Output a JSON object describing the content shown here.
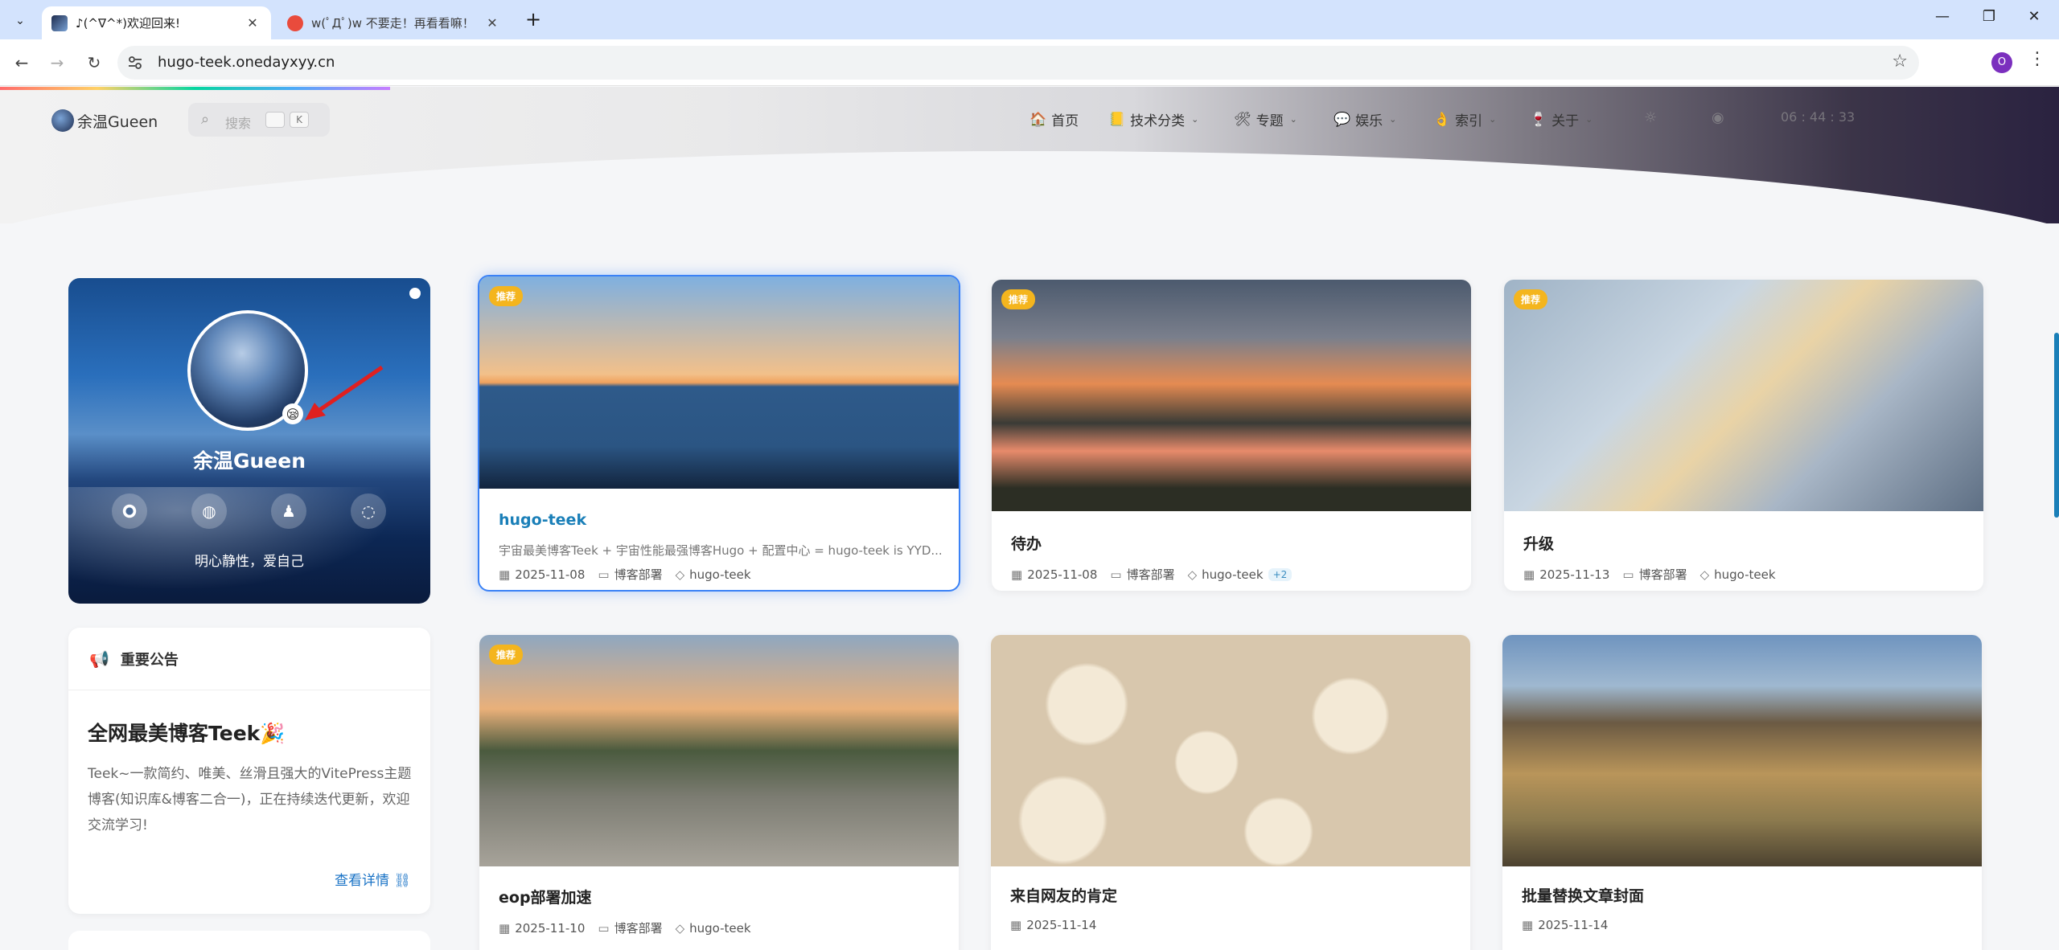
{
  "browser": {
    "tabs": [
      {
        "title": "♪(^∇^*)欢迎回来!",
        "active": true
      },
      {
        "title": "w(ﾟДﾟ)w 不要走！再看看嘛！",
        "active": false
      }
    ],
    "url": "hugo-teek.onedayxyy.cn",
    "profile_initial": "O"
  },
  "site": {
    "logo_text": "余温Gueen",
    "search": {
      "placeholder": "搜索",
      "key1": "",
      "key2": "K"
    },
    "nav": [
      {
        "label": "首页",
        "icon": "🏠",
        "has_dropdown": false
      },
      {
        "label": "技术分类",
        "icon": "📒",
        "has_dropdown": true
      },
      {
        "label": "专题",
        "icon": "🛠",
        "has_dropdown": true
      },
      {
        "label": "娱乐",
        "icon": "💬",
        "has_dropdown": true
      },
      {
        "label": "索引",
        "icon": "👌",
        "has_dropdown": true
      },
      {
        "label": "关于",
        "icon": "🍷",
        "has_dropdown": true
      }
    ],
    "clock": "06 : 44 : 33"
  },
  "profile": {
    "name": "余温Gueen",
    "motto": "明心静性，爱自己",
    "socials": [
      "github-icon",
      "dribbble-icon",
      "qq-icon",
      "wechat-icon"
    ],
    "status_emoji": "😪"
  },
  "notice": {
    "header": "重要公告",
    "title": "全网最美博客Teek🎉",
    "body": "Teek~一款简约、唯美、丝滑且强大的VitePress主题博客(知识库&博客二合一)，正在持续迭代更新，欢迎交流学习!",
    "link": "查看详情"
  },
  "posts": [
    {
      "title": "hugo-teek",
      "recommended": true,
      "excerpt": "宇宙最美博客Teek + 宇宙性能最强博客Hugo + 配置中心 = hugo-teek is YYD...",
      "date": "2025-11-08",
      "category": "博客部署",
      "tag": "hugo-teek",
      "extra": ""
    },
    {
      "title": "待办",
      "recommended": true,
      "excerpt": "",
      "date": "2025-11-08",
      "category": "博客部署",
      "tag": "hugo-teek",
      "extra": "+2"
    },
    {
      "title": "升级",
      "recommended": true,
      "excerpt": "",
      "date": "2025-11-13",
      "category": "博客部署",
      "tag": "hugo-teek",
      "extra": ""
    },
    {
      "title": "eop部署加速",
      "recommended": true,
      "excerpt": "",
      "date": "2025-11-10",
      "category": "博客部署",
      "tag": "hugo-teek",
      "extra": ""
    },
    {
      "title": "来自网友的肯定",
      "recommended": false,
      "excerpt": "",
      "date": "2025-11-14",
      "category": "",
      "tag": "",
      "extra": ""
    },
    {
      "title": "批量替换文章封面",
      "recommended": false,
      "excerpt": "",
      "date": "2025-11-14",
      "category": "",
      "tag": "",
      "extra": ""
    }
  ],
  "labels": {
    "recommended": "推荐"
  },
  "colors": {
    "accent": "#1a7fb8",
    "recommend_badge": "#f4b51e",
    "active_outline": "#3b82f6"
  }
}
